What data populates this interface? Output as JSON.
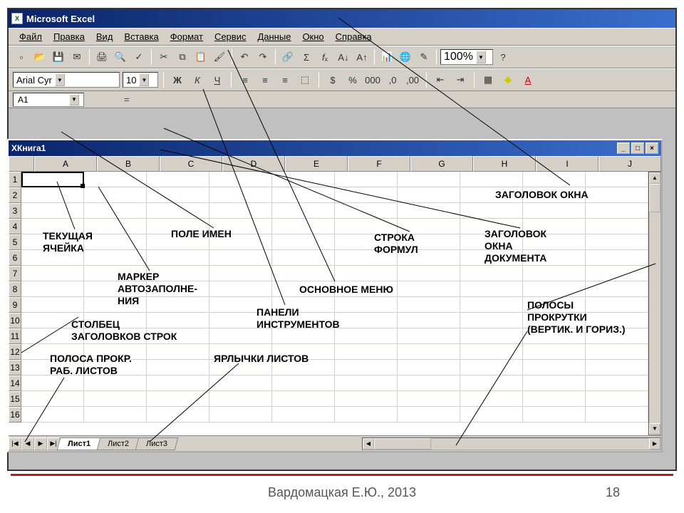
{
  "app": {
    "title": "Microsoft Excel"
  },
  "menu": {
    "items": [
      "Файл",
      "Правка",
      "Вид",
      "Вставка",
      "Формат",
      "Сервис",
      "Данные",
      "Окно",
      "Справка"
    ]
  },
  "toolbar": {
    "zoom": "100%"
  },
  "format": {
    "font": "Arial Cyr",
    "size": "10",
    "bold": "Ж",
    "italic": "К",
    "underline": "Ч",
    "currency": "%"
  },
  "namebox": {
    "value": "A1",
    "fx": "="
  },
  "workbook": {
    "title": "Книга1",
    "columns": [
      "A",
      "B",
      "C",
      "D",
      "E",
      "F",
      "G",
      "H",
      "I",
      "J"
    ],
    "rows": [
      "1",
      "2",
      "3",
      "4",
      "5",
      "6",
      "7",
      "8",
      "9",
      "10",
      "11",
      "12",
      "13",
      "14",
      "15",
      "16"
    ],
    "tabs": [
      "Лист1",
      "Лист2",
      "Лист3"
    ]
  },
  "annotations": {
    "title_win": "ЗАГОЛОВОК ОКНА",
    "doc_title": "ЗАГОЛОВОК\nОКНА\nДОКУМЕНТА",
    "formula_bar": "СТРОКА\nФОРМУЛ",
    "main_menu": "ОСНОВНОЕ МЕНЮ",
    "toolbars": "ПАНЕЛИ\nИНСТРУМЕНТОВ",
    "namefield": "ПОЛЕ ИМЕН",
    "active_cell": "ТЕКУЩАЯ\nЯЧЕЙКА",
    "fill_handle": "МАРКЕР\nАВТОЗАПОЛНЕ-\nНИЯ",
    "row_headers": "СТОЛБЕЦ\nЗАГОЛОВКОВ СТРОК",
    "sheet_scroll": "ПОЛОСА ПРОКР.\nРАБ. ЛИСТОВ",
    "sheet_tabs": "ЯРЛЫЧКИ ЛИСТОВ",
    "scrollbars": "ПОЛОСЫ\nПРОКРУТКИ\n(ВЕРТИК. И ГОРИЗ.)"
  },
  "footer": {
    "author": "Вардомацкая Е.Ю., 2013",
    "page": "18"
  }
}
